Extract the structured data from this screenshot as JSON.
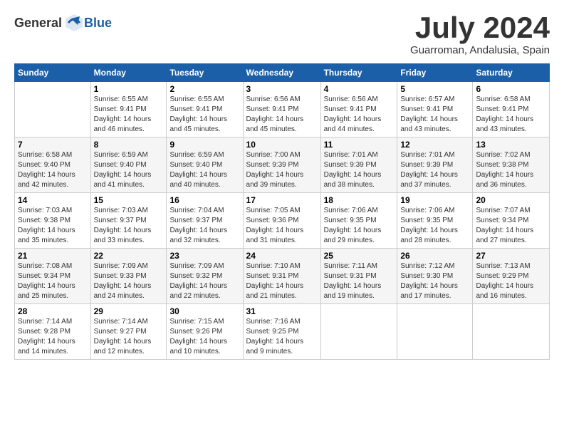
{
  "logo": {
    "text_general": "General",
    "text_blue": "Blue"
  },
  "title": "July 2024",
  "location": "Guarroman, Andalusia, Spain",
  "days_of_week": [
    "Sunday",
    "Monday",
    "Tuesday",
    "Wednesday",
    "Thursday",
    "Friday",
    "Saturday"
  ],
  "weeks": [
    [
      {
        "day": "",
        "info": ""
      },
      {
        "day": "1",
        "info": "Sunrise: 6:55 AM\nSunset: 9:41 PM\nDaylight: 14 hours\nand 46 minutes."
      },
      {
        "day": "2",
        "info": "Sunrise: 6:55 AM\nSunset: 9:41 PM\nDaylight: 14 hours\nand 45 minutes."
      },
      {
        "day": "3",
        "info": "Sunrise: 6:56 AM\nSunset: 9:41 PM\nDaylight: 14 hours\nand 45 minutes."
      },
      {
        "day": "4",
        "info": "Sunrise: 6:56 AM\nSunset: 9:41 PM\nDaylight: 14 hours\nand 44 minutes."
      },
      {
        "day": "5",
        "info": "Sunrise: 6:57 AM\nSunset: 9:41 PM\nDaylight: 14 hours\nand 43 minutes."
      },
      {
        "day": "6",
        "info": "Sunrise: 6:58 AM\nSunset: 9:41 PM\nDaylight: 14 hours\nand 43 minutes."
      }
    ],
    [
      {
        "day": "7",
        "info": "Sunrise: 6:58 AM\nSunset: 9:40 PM\nDaylight: 14 hours\nand 42 minutes."
      },
      {
        "day": "8",
        "info": "Sunrise: 6:59 AM\nSunset: 9:40 PM\nDaylight: 14 hours\nand 41 minutes."
      },
      {
        "day": "9",
        "info": "Sunrise: 6:59 AM\nSunset: 9:40 PM\nDaylight: 14 hours\nand 40 minutes."
      },
      {
        "day": "10",
        "info": "Sunrise: 7:00 AM\nSunset: 9:39 PM\nDaylight: 14 hours\nand 39 minutes."
      },
      {
        "day": "11",
        "info": "Sunrise: 7:01 AM\nSunset: 9:39 PM\nDaylight: 14 hours\nand 38 minutes."
      },
      {
        "day": "12",
        "info": "Sunrise: 7:01 AM\nSunset: 9:39 PM\nDaylight: 14 hours\nand 37 minutes."
      },
      {
        "day": "13",
        "info": "Sunrise: 7:02 AM\nSunset: 9:38 PM\nDaylight: 14 hours\nand 36 minutes."
      }
    ],
    [
      {
        "day": "14",
        "info": "Sunrise: 7:03 AM\nSunset: 9:38 PM\nDaylight: 14 hours\nand 35 minutes."
      },
      {
        "day": "15",
        "info": "Sunrise: 7:03 AM\nSunset: 9:37 PM\nDaylight: 14 hours\nand 33 minutes."
      },
      {
        "day": "16",
        "info": "Sunrise: 7:04 AM\nSunset: 9:37 PM\nDaylight: 14 hours\nand 32 minutes."
      },
      {
        "day": "17",
        "info": "Sunrise: 7:05 AM\nSunset: 9:36 PM\nDaylight: 14 hours\nand 31 minutes."
      },
      {
        "day": "18",
        "info": "Sunrise: 7:06 AM\nSunset: 9:35 PM\nDaylight: 14 hours\nand 29 minutes."
      },
      {
        "day": "19",
        "info": "Sunrise: 7:06 AM\nSunset: 9:35 PM\nDaylight: 14 hours\nand 28 minutes."
      },
      {
        "day": "20",
        "info": "Sunrise: 7:07 AM\nSunset: 9:34 PM\nDaylight: 14 hours\nand 27 minutes."
      }
    ],
    [
      {
        "day": "21",
        "info": "Sunrise: 7:08 AM\nSunset: 9:34 PM\nDaylight: 14 hours\nand 25 minutes."
      },
      {
        "day": "22",
        "info": "Sunrise: 7:09 AM\nSunset: 9:33 PM\nDaylight: 14 hours\nand 24 minutes."
      },
      {
        "day": "23",
        "info": "Sunrise: 7:09 AM\nSunset: 9:32 PM\nDaylight: 14 hours\nand 22 minutes."
      },
      {
        "day": "24",
        "info": "Sunrise: 7:10 AM\nSunset: 9:31 PM\nDaylight: 14 hours\nand 21 minutes."
      },
      {
        "day": "25",
        "info": "Sunrise: 7:11 AM\nSunset: 9:31 PM\nDaylight: 14 hours\nand 19 minutes."
      },
      {
        "day": "26",
        "info": "Sunrise: 7:12 AM\nSunset: 9:30 PM\nDaylight: 14 hours\nand 17 minutes."
      },
      {
        "day": "27",
        "info": "Sunrise: 7:13 AM\nSunset: 9:29 PM\nDaylight: 14 hours\nand 16 minutes."
      }
    ],
    [
      {
        "day": "28",
        "info": "Sunrise: 7:14 AM\nSunset: 9:28 PM\nDaylight: 14 hours\nand 14 minutes."
      },
      {
        "day": "29",
        "info": "Sunrise: 7:14 AM\nSunset: 9:27 PM\nDaylight: 14 hours\nand 12 minutes."
      },
      {
        "day": "30",
        "info": "Sunrise: 7:15 AM\nSunset: 9:26 PM\nDaylight: 14 hours\nand 10 minutes."
      },
      {
        "day": "31",
        "info": "Sunrise: 7:16 AM\nSunset: 9:25 PM\nDaylight: 14 hours\nand 9 minutes."
      },
      {
        "day": "",
        "info": ""
      },
      {
        "day": "",
        "info": ""
      },
      {
        "day": "",
        "info": ""
      }
    ]
  ]
}
